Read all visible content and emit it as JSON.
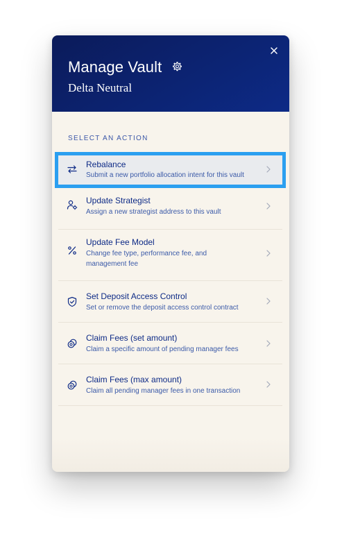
{
  "modal": {
    "title": "Manage Vault",
    "subtitle": "Delta Neutral",
    "close_icon": "close-icon",
    "settings_icon": "gear-icon"
  },
  "section_label": "SELECT AN ACTION",
  "actions": [
    {
      "title": "Rebalance",
      "description": "Submit a new portfolio allocation intent for this vault",
      "icon": "swap-arrows-icon",
      "selected": true
    },
    {
      "title": "Update Strategist",
      "description": "Assign a new strategist address to this vault",
      "icon": "user-gear-icon",
      "selected": false
    },
    {
      "title": "Update Fee Model",
      "description": "Change fee type, performance fee, and management fee",
      "icon": "percent-icon",
      "selected": false
    },
    {
      "title": "Set Deposit Access Control",
      "description": "Set or remove the deposit access control contract",
      "icon": "shield-check-icon",
      "selected": false
    },
    {
      "title": "Claim Fees (set amount)",
      "description": "Claim a specific amount of pending manager fees",
      "icon": "coins-icon",
      "selected": false
    },
    {
      "title": "Claim Fees (max amount)",
      "description": "Claim all pending manager fees in one transaction",
      "icon": "coins-icon",
      "selected": false
    }
  ],
  "colors": {
    "header_bg": "#0d2a86",
    "panel_bg": "#f8f4ec",
    "accent_text": "#0d2a86",
    "selection_outline": "#2b9ff0"
  }
}
